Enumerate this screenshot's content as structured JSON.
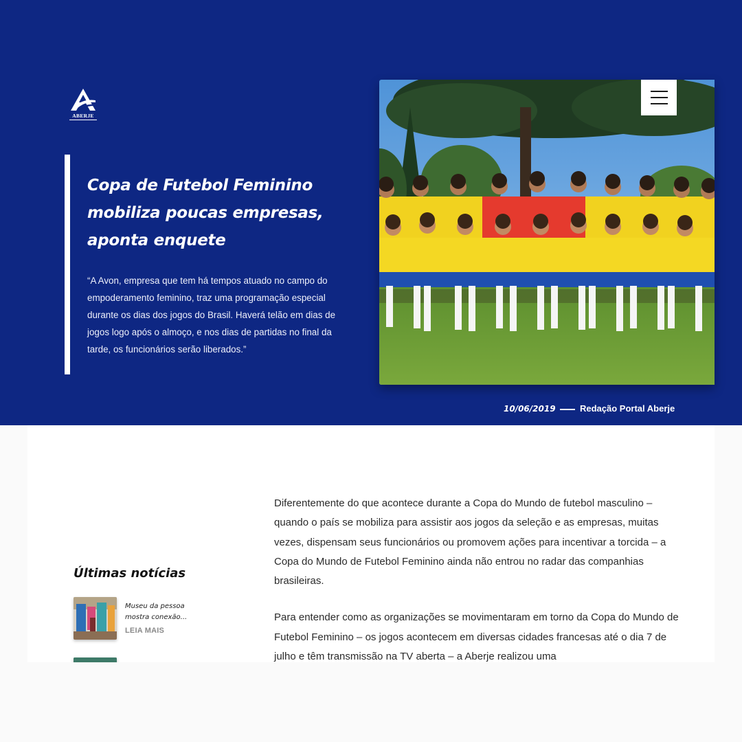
{
  "brand": {
    "logo_text": "ABERJE",
    "accent_color": "#0e2783"
  },
  "header": {
    "menu_icon": "hamburger-menu-icon",
    "headline": "Copa de Futebol Feminino mobiliza poucas empresas, aponta enquete",
    "quote": "“A Avon, empresa que tem há tempos atuado no campo do empoderamento feminino, traz uma programação especial durante os dias dos jogos do Brasil. Haverá telão em dias de jogos logo após o almoço, e nos dias de partidas no final da tarde, os funcionários serão liberados.”",
    "date": "10/06/2019",
    "author": "Redação Portal Aberje"
  },
  "sidebar": {
    "title": "Últimas notícias",
    "news": [
      {
        "title": "Museu da pessoa mostra conexão...",
        "more": "LEIA MAIS"
      }
    ]
  },
  "article": {
    "paragraphs": [
      "Diferentemente do que acontece durante a Copa do Mundo de futebol masculino – quando o país se mobiliza para assistir aos jogos da seleção e as empresas, muitas vezes, dispensam seus funcionários ou promovem ações para incentivar a torcida – a Copa do Mundo de Futebol Feminino ainda não entrou no radar das companhias brasileiras.",
      "Para entender como as organizações se movimentaram em torno da Copa do Mundo de Futebol Feminino – os jogos acontecem em diversas cidades francesas até o dia 7 de julho e têm transmissão na TV aberta – a Aberje realizou uma"
    ]
  }
}
